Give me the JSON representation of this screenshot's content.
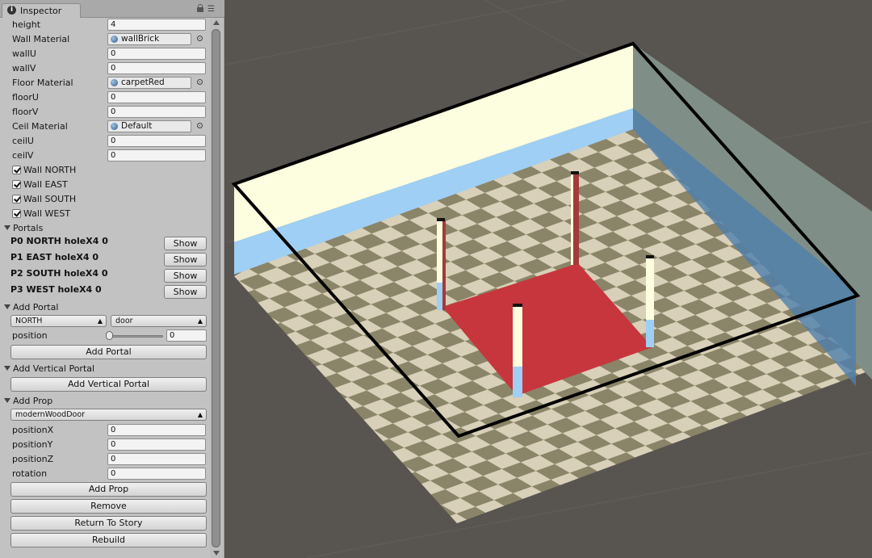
{
  "inspector": {
    "tab_label": "Inspector",
    "tab_icon": "info-icon",
    "fields": {
      "height": {
        "label": "height",
        "value": "4"
      },
      "wall_material": {
        "label": "Wall Material",
        "value": "wallBrick"
      },
      "wallU": {
        "label": "wallU",
        "value": "0"
      },
      "wallV": {
        "label": "wallV",
        "value": "0"
      },
      "floor_material": {
        "label": "Floor Material",
        "value": "carpetRed"
      },
      "floorU": {
        "label": "floorU",
        "value": "0"
      },
      "floorV": {
        "label": "floorV",
        "value": "0"
      },
      "ceil_material": {
        "label": "Ceil Material",
        "value": "Default"
      },
      "ceilU": {
        "label": "ceilU",
        "value": "0"
      },
      "ceilV": {
        "label": "ceilV",
        "value": "0"
      }
    },
    "walls": [
      {
        "label": "Wall NORTH",
        "checked": true
      },
      {
        "label": "Wall EAST",
        "checked": true
      },
      {
        "label": "Wall SOUTH",
        "checked": true
      },
      {
        "label": "Wall WEST",
        "checked": true
      }
    ],
    "portals": {
      "header": "Portals",
      "items": [
        {
          "label": "P0 NORTH holeX4 0",
          "button": "Show"
        },
        {
          "label": "P1 EAST holeX4 0",
          "button": "Show"
        },
        {
          "label": "P2 SOUTH holeX4 0",
          "button": "Show"
        },
        {
          "label": "P3 WEST holeX4 0",
          "button": "Show"
        }
      ]
    },
    "add_portal": {
      "header": "Add Portal",
      "direction": "NORTH",
      "type": "door",
      "position_label": "position",
      "position_value": "0",
      "slider_fraction": 0.0,
      "button": "Add Portal"
    },
    "add_vertical_portal": {
      "header": "Add Vertical Portal",
      "button": "Add Vertical Portal"
    },
    "add_prop": {
      "header": "Add Prop",
      "prop": "modernWoodDoor",
      "positionX": {
        "label": "positionX",
        "value": "0"
      },
      "positionY": {
        "label": "positionY",
        "value": "0"
      },
      "positionZ": {
        "label": "positionZ",
        "value": "0"
      },
      "rotation": {
        "label": "rotation",
        "value": "0"
      },
      "button": "Add Prop"
    },
    "actions": {
      "remove": "Remove",
      "return_to_story": "Return To Story",
      "rebuild": "Rebuild"
    }
  },
  "scene": {
    "background_color": "#585450",
    "wall_color": "#fdfde0",
    "wall_stripe_color": "#9fcff4",
    "side_wall_color": "#7f8f88",
    "carpet_color": "#c7363d",
    "tile_light": "#d8d0b8",
    "tile_dark": "#8a8468",
    "outline_color": "#000000"
  }
}
